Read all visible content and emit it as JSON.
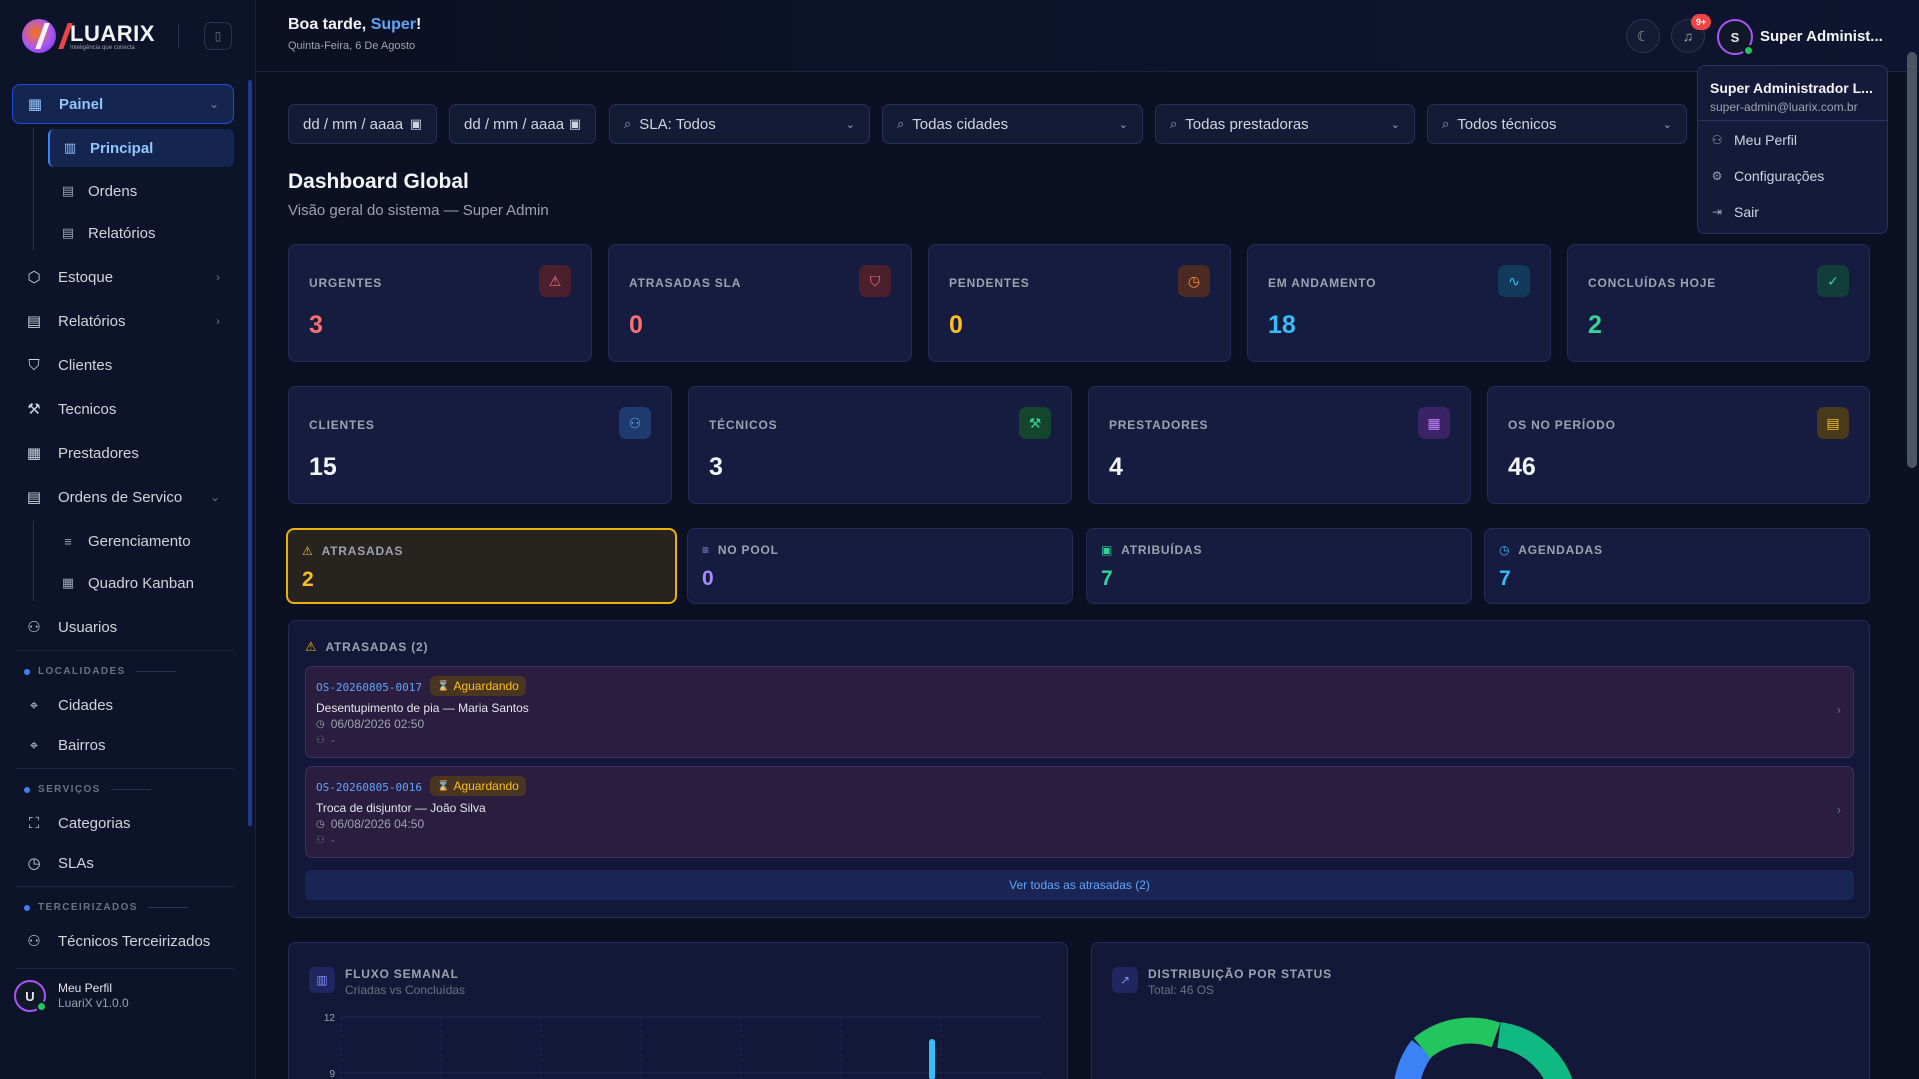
{
  "brand": {
    "name": "LUARIX",
    "tagline": "Inteligência que conecta"
  },
  "sidebar": {
    "panel": {
      "label": "Painel",
      "sub": [
        "Principal",
        "Ordens",
        "Relatórios"
      ]
    },
    "estoque": "Estoque",
    "relatorios": "Relatórios",
    "clientes": "Clientes",
    "tecnicos": "Tecnicos",
    "prestadores": "Prestadores",
    "ordens": {
      "label": "Ordens de Servico",
      "sub": [
        "Gerenciamento",
        "Quadro Kanban"
      ]
    },
    "usuarios": "Usuarios",
    "localidades": {
      "label": "LOCALIDADES",
      "items": [
        "Cidades",
        "Bairros"
      ]
    },
    "servicos": {
      "label": "SERVIÇOS",
      "items": [
        "Categorias",
        "SLAs"
      ]
    },
    "terceirizados": {
      "label": "TERCEIRIZADOS",
      "items": [
        "Técnicos Terceirizados"
      ]
    },
    "profile": {
      "initial": "U",
      "name": "Meu Perfil",
      "version": "LuariX v1.0.0"
    }
  },
  "header": {
    "greeting_prefix": "Boa tarde, ",
    "greeting_name": "Super",
    "greeting_suffix": "!",
    "date": "Quinta-Feira, 6 De Agosto",
    "notif_badge": "9+",
    "user_initial": "S",
    "user_name": "Super Administ..."
  },
  "dropdown": {
    "name": "Super Administrador L...",
    "email": "super-admin@luarix.com.br",
    "items": [
      "Meu Perfil",
      "Configurações",
      "Sair"
    ]
  },
  "filters": {
    "date_from": "dd / mm / aaaa",
    "date_to": "dd / mm / aaaa",
    "sla": "SLA: Todos",
    "cidades": "Todas cidades",
    "prestadoras": "Todas prestadoras",
    "tecnicos": "Todos técnicos"
  },
  "page": {
    "title": "Dashboard Global",
    "subtitle": "Visão geral do sistema — Super Admin"
  },
  "stats_row1": [
    {
      "label": "URGENTES",
      "value": "3",
      "color": "#f87171"
    },
    {
      "label": "ATRASADAS SLA",
      "value": "0",
      "color": "#f87171"
    },
    {
      "label": "PENDENTES",
      "value": "0",
      "color": "#fbbf24"
    },
    {
      "label": "EM ANDAMENTO",
      "value": "18",
      "color": "#38bdf8"
    },
    {
      "label": "CONCLUÍDAS HOJE",
      "value": "2",
      "color": "#34d399"
    }
  ],
  "stats_row2": [
    {
      "label": "CLIENTES",
      "value": "15"
    },
    {
      "label": "TÉCNICOS",
      "value": "3"
    },
    {
      "label": "PRESTADORES",
      "value": "4"
    },
    {
      "label": "OS NO PERÍODO",
      "value": "46"
    }
  ],
  "mini_stats": [
    {
      "label": "ATRASADAS",
      "value": "2",
      "color": "#fbbf24"
    },
    {
      "label": "NO POOL",
      "value": "0",
      "color": "#a78bfa"
    },
    {
      "label": "ATRIBUÍDAS",
      "value": "7",
      "color": "#34d399"
    },
    {
      "label": "AGENDADAS",
      "value": "7",
      "color": "#38bdf8"
    }
  ],
  "overdue": {
    "title": "ATRASADAS (2)",
    "items": [
      {
        "id": "OS-20260805-0017",
        "status": "Aguardando",
        "desc": "Desentupimento de pia — Maria Santos",
        "date": "06/08/2026 02:50",
        "tech": "-"
      },
      {
        "id": "OS-20260805-0016",
        "status": "Aguardando",
        "desc": "Troca de disjuntor — João Silva",
        "date": "06/08/2026 04:50",
        "tech": "-"
      }
    ],
    "view_all": "Ver todas as atrasadas (2)"
  },
  "charts": {
    "weekly": {
      "title": "FLUXO SEMANAL",
      "subtitle": "Criadas vs Concluídas",
      "ticks": [
        "12",
        "9"
      ]
    },
    "status": {
      "title": "DISTRIBUIÇÃO POR STATUS",
      "subtitle": "Total: 46 OS"
    }
  }
}
